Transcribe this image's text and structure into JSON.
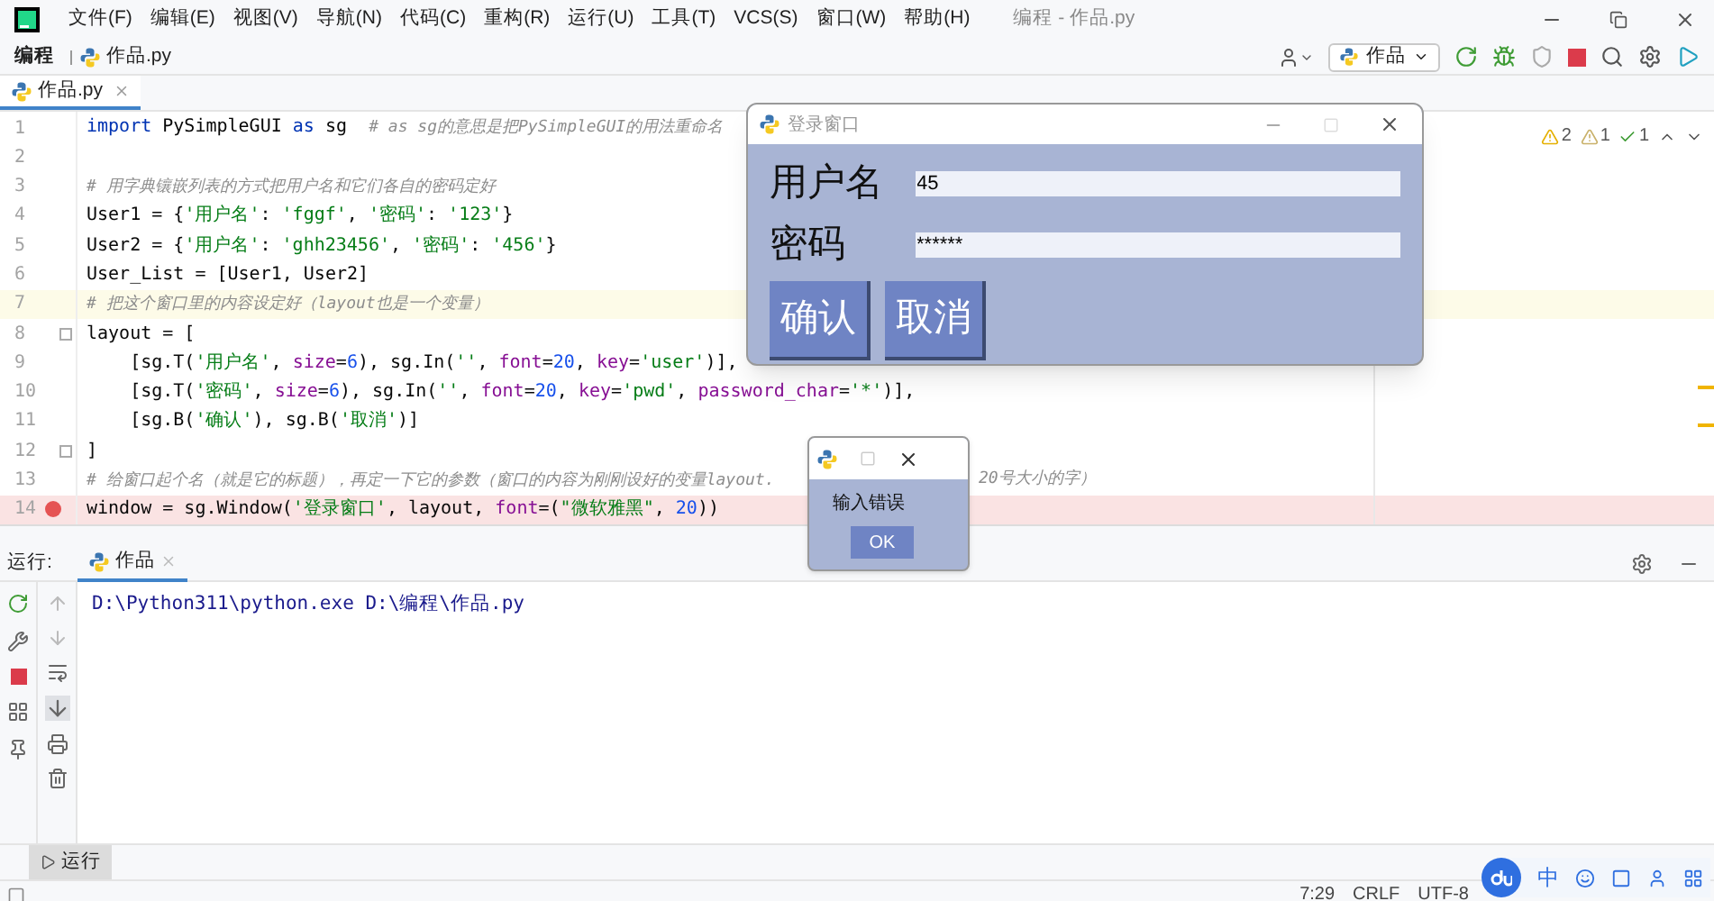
{
  "window": {
    "title": "编程 - 作品.py"
  },
  "menu": [
    "文件(F)",
    "编辑(E)",
    "视图(V)",
    "导航(N)",
    "代码(C)",
    "重构(R)",
    "运行(U)",
    "工具(T)",
    "VCS(S)",
    "窗口(W)",
    "帮助(H)"
  ],
  "breadcrumb": [
    {
      "label": "编程",
      "kind": "folder"
    },
    {
      "label": "作品.py",
      "kind": "file"
    }
  ],
  "run_config": {
    "label": "作品"
  },
  "editor_tabs": [
    {
      "label": "作品.py",
      "selected": true
    }
  ],
  "inspections": [
    {
      "kind": "warning",
      "count": "2"
    },
    {
      "kind": "weak",
      "count": "1"
    },
    {
      "kind": "ok",
      "count": "1"
    }
  ],
  "code": [
    {
      "n": "1",
      "current": false,
      "breakpoint": false,
      "fold": false,
      "tokens": [
        {
          "kind": "kw",
          "text": "import"
        },
        {
          "kind": "p",
          "text": " PySimpleGUI "
        },
        {
          "kind": "kw",
          "text": "as"
        },
        {
          "kind": "p",
          "text": " sg  "
        },
        {
          "kind": "c",
          "text": "# as sg的意思是把PySimpleGUI的用法重命名"
        }
      ]
    },
    {
      "n": "2",
      "current": false,
      "breakpoint": false,
      "fold": false
    },
    {
      "n": "3",
      "current": false,
      "breakpoint": false,
      "fold": false,
      "tokens": [
        {
          "kind": "c",
          "text": "# 用字典镶嵌列表的方式把用户名和它们各自的密码定好"
        }
      ]
    },
    {
      "n": "4",
      "current": false,
      "breakpoint": false,
      "fold": false,
      "tokens": [
        {
          "kind": "p",
          "text": "User1 = {"
        },
        {
          "kind": "s",
          "text": "'用户名'"
        },
        {
          "kind": "p",
          "text": ": "
        },
        {
          "kind": "s",
          "text": "'fggf'"
        },
        {
          "kind": "p",
          "text": ", "
        },
        {
          "kind": "s",
          "text": "'密码'"
        },
        {
          "kind": "p",
          "text": ": "
        },
        {
          "kind": "s",
          "text": "'123'"
        },
        {
          "kind": "p",
          "text": "}"
        }
      ]
    },
    {
      "n": "5",
      "current": false,
      "breakpoint": false,
      "fold": false,
      "tokens": [
        {
          "kind": "p",
          "text": "User2 = {"
        },
        {
          "kind": "s",
          "text": "'用户名'"
        },
        {
          "kind": "p",
          "text": ": "
        },
        {
          "kind": "s",
          "text": "'ghh23456'"
        },
        {
          "kind": "p",
          "text": ", "
        },
        {
          "kind": "s",
          "text": "'密码'"
        },
        {
          "kind": "p",
          "text": ": "
        },
        {
          "kind": "s",
          "text": "'456'"
        },
        {
          "kind": "p",
          "text": "}"
        }
      ]
    },
    {
      "n": "6",
      "current": false,
      "breakpoint": false,
      "fold": false,
      "tokens": [
        {
          "kind": "p",
          "text": "User_List = [User1, User2]"
        }
      ]
    },
    {
      "n": "7",
      "current": true,
      "breakpoint": false,
      "fold": false,
      "tokens": [
        {
          "kind": "c",
          "text": "# 把这个窗口里的内容设定好（layout也是一个变量）"
        }
      ]
    },
    {
      "n": "8",
      "current": false,
      "breakpoint": false,
      "fold": true,
      "tokens": [
        {
          "kind": "p",
          "text": "layout = ["
        }
      ]
    },
    {
      "n": "9",
      "current": false,
      "breakpoint": false,
      "fold": false,
      "tokens": [
        {
          "kind": "p",
          "text": "    [sg.T("
        },
        {
          "kind": "s",
          "text": "'用户名'"
        },
        {
          "kind": "p",
          "text": ", "
        },
        {
          "kind": "a",
          "text": "size"
        },
        {
          "kind": "p",
          "text": "="
        },
        {
          "kind": "num",
          "text": "6"
        },
        {
          "kind": "p",
          "text": "), sg.In("
        },
        {
          "kind": "s",
          "text": "''"
        },
        {
          "kind": "p",
          "text": ", "
        },
        {
          "kind": "a",
          "text": "font"
        },
        {
          "kind": "p",
          "text": "="
        },
        {
          "kind": "num",
          "text": "20"
        },
        {
          "kind": "p",
          "text": ", "
        },
        {
          "kind": "a",
          "text": "key"
        },
        {
          "kind": "p",
          "text": "="
        },
        {
          "kind": "s",
          "text": "'user'"
        },
        {
          "kind": "p",
          "text": ")],"
        }
      ]
    },
    {
      "n": "10",
      "current": false,
      "breakpoint": false,
      "fold": false,
      "tokens": [
        {
          "kind": "p",
          "text": "    [sg.T("
        },
        {
          "kind": "s",
          "text": "'密码'"
        },
        {
          "kind": "p",
          "text": ", "
        },
        {
          "kind": "a",
          "text": "size"
        },
        {
          "kind": "p",
          "text": "="
        },
        {
          "kind": "num",
          "text": "6"
        },
        {
          "kind": "p",
          "text": "), sg.In("
        },
        {
          "kind": "s",
          "text": "''"
        },
        {
          "kind": "p",
          "text": ", "
        },
        {
          "kind": "a",
          "text": "font"
        },
        {
          "kind": "p",
          "text": "="
        },
        {
          "kind": "num",
          "text": "20"
        },
        {
          "kind": "p",
          "text": ", "
        },
        {
          "kind": "a",
          "text": "key"
        },
        {
          "kind": "p",
          "text": "="
        },
        {
          "kind": "s",
          "text": "'pwd'"
        },
        {
          "kind": "p",
          "text": ", "
        },
        {
          "kind": "a",
          "text": "password_char"
        },
        {
          "kind": "p",
          "text": "="
        },
        {
          "kind": "s",
          "text": "'*'"
        },
        {
          "kind": "p",
          "text": ")],"
        }
      ]
    },
    {
      "n": "11",
      "current": false,
      "breakpoint": false,
      "fold": false,
      "tokens": [
        {
          "kind": "p",
          "text": "    [sg.B("
        },
        {
          "kind": "s",
          "text": "'确认'"
        },
        {
          "kind": "p",
          "text": "), sg.B("
        },
        {
          "kind": "s",
          "text": "'取消'"
        },
        {
          "kind": "p",
          "text": ")]"
        }
      ]
    },
    {
      "n": "12",
      "current": false,
      "breakpoint": false,
      "fold": true,
      "tokens": [
        {
          "kind": "p",
          "text": "]"
        }
      ]
    },
    {
      "n": "13",
      "current": false,
      "breakpoint": false,
      "fold": false,
      "tokens": [
        {
          "kind": "c",
          "text": "# 给窗口起个名（就是它的标题），再定一下它的参数（窗口的内容为刚刚设好的变量layout."
        },
        {
          "kind": "cont",
          "text": "20号大小的字）"
        }
      ]
    },
    {
      "n": "14",
      "current": false,
      "breakpoint": true,
      "fold": false,
      "tokens": [
        {
          "kind": "p",
          "text": "window = sg.Window("
        },
        {
          "kind": "s",
          "text": "'登录窗口'"
        },
        {
          "kind": "p",
          "text": ", layout, "
        },
        {
          "kind": "a",
          "text": "font"
        },
        {
          "kind": "p",
          "text": "=("
        },
        {
          "kind": "s",
          "text": "\"微软雅黑\""
        },
        {
          "kind": "p",
          "text": ", "
        },
        {
          "kind": "num",
          "text": "20"
        },
        {
          "kind": "p",
          "text": "))"
        }
      ]
    }
  ],
  "run_panel": {
    "label": "运行:",
    "tabs": [
      {
        "label": "作品",
        "selected": true
      }
    ],
    "console": [
      "D:\\Python311\\python.exe D:\\编程\\作品.py"
    ]
  },
  "tool_window_bar": [
    {
      "label": "运行",
      "selected": true
    }
  ],
  "status_bar": [
    "7:29",
    "CRLF",
    "UTF-8"
  ],
  "ime": {
    "mode": "中"
  },
  "login_window": {
    "title": "登录窗口",
    "fields": [
      {
        "label": "用户名",
        "value": "45"
      },
      {
        "label": "密码",
        "value": "******"
      }
    ],
    "buttons": [
      "确认",
      "取消"
    ]
  },
  "popup": {
    "message": "输入错误",
    "button": "OK"
  }
}
